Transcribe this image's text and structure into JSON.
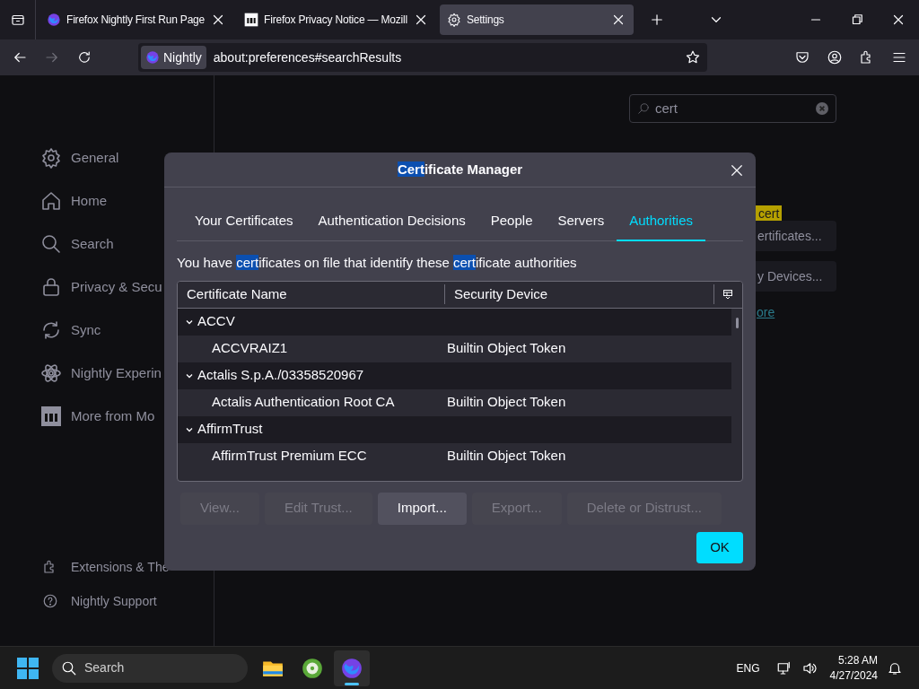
{
  "tabs": [
    {
      "title": "Firefox Nightly First Run Page",
      "selected": false
    },
    {
      "title": "Firefox Privacy Notice — Mozill",
      "selected": false
    },
    {
      "title": "Settings",
      "selected": true
    }
  ],
  "toolbar": {
    "identity": "Nightly",
    "url": "about:preferences#searchResults",
    "forward_disabled": true
  },
  "settings": {
    "search": {
      "value": "cert"
    },
    "sidebar": {
      "items": [
        {
          "label": "General"
        },
        {
          "label": "Home"
        },
        {
          "label": "Search"
        },
        {
          "label": "Privacy & Secu"
        },
        {
          "label": "Sync"
        },
        {
          "label": "Nightly Experin"
        },
        {
          "label": "More from Mo"
        }
      ],
      "footer": [
        {
          "label": "Extensions & The"
        },
        {
          "label": "Nightly Support"
        }
      ]
    },
    "tooltip": "cert",
    "buttons": [
      "ertificates...",
      "y Devices..."
    ],
    "link": "ore"
  },
  "dialog": {
    "title": [
      {
        "text": "Cert",
        "highlighted": true
      },
      {
        "text": "ificate Manager",
        "highlighted": false
      }
    ],
    "tabs": [
      {
        "label": "Your Certificates",
        "selected": false
      },
      {
        "label": "Authentication Decisions",
        "selected": false
      },
      {
        "label": "People",
        "selected": false
      },
      {
        "label": "Servers",
        "selected": false
      },
      {
        "label": "Authorities",
        "selected": true
      }
    ],
    "description": [
      {
        "text": "You have ",
        "highlighted": false
      },
      {
        "text": "cert",
        "highlighted": true
      },
      {
        "text": "ificates on file that identify these ",
        "highlighted": false
      },
      {
        "text": "cert",
        "highlighted": true
      },
      {
        "text": "ificate authorities",
        "highlighted": false
      }
    ],
    "table": {
      "columns": [
        "Certificate Name",
        "Security Device"
      ],
      "rows": [
        {
          "name": "ACCV",
          "expanded": true,
          "children": [
            {
              "name": "ACCVRAIZ1",
              "device": "Builtin Object Token"
            }
          ]
        },
        {
          "name": "Actalis S.p.A./03358520967",
          "expanded": true,
          "children": [
            {
              "name": "Actalis Authentication Root CA",
              "device": "Builtin Object Token"
            }
          ]
        },
        {
          "name": "AffirmTrust",
          "expanded": true,
          "children": [
            {
              "name": "AffirmTrust Premium ECC",
              "device": "Builtin Object Token"
            }
          ]
        }
      ]
    },
    "buttons": [
      {
        "label": "View...",
        "disabled": true
      },
      {
        "label": "Edit Trust...",
        "disabled": true
      },
      {
        "label": "Import...",
        "disabled": false
      },
      {
        "label": "Export...",
        "disabled": true
      },
      {
        "label": "Delete or Distrust...",
        "disabled": true
      }
    ],
    "ok": "OK"
  },
  "taskbar": {
    "search": "Search",
    "apps": [
      {
        "active": false
      },
      {
        "active": false
      },
      {
        "active": true
      }
    ],
    "language": "ENG",
    "time": "5:28 AM",
    "date": "4/27/2024"
  }
}
